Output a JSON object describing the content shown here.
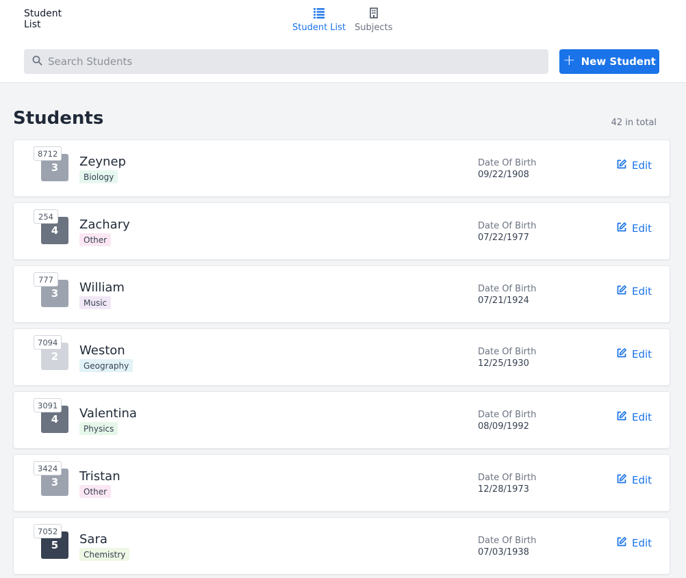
{
  "app": {
    "brand_line1": "Student",
    "brand_line2": "List"
  },
  "nav": [
    {
      "label": "Student List",
      "icon": "list-icon",
      "active": true
    },
    {
      "label": "Subjects",
      "icon": "building-icon",
      "active": false
    }
  ],
  "search": {
    "placeholder": "Search Students",
    "value": ""
  },
  "new_button": {
    "label": "New Student"
  },
  "page": {
    "title": "Students",
    "total": "42 in total"
  },
  "row_labels": {
    "dob": "Date Of Birth",
    "edit": "Edit"
  },
  "students": [
    {
      "id": "8712",
      "grade": "3",
      "grade_color": "#9ca3af",
      "name": "Zeynep",
      "subject": "Biology",
      "subject_color": "#e6f7ef",
      "dob": "09/22/1908"
    },
    {
      "id": "254",
      "grade": "4",
      "grade_color": "#6b7280",
      "name": "Zachary",
      "subject": "Other",
      "subject_color": "#fbe7f3",
      "dob": "07/22/1977"
    },
    {
      "id": "777",
      "grade": "3",
      "grade_color": "#9ca3af",
      "name": "William",
      "subject": "Music",
      "subject_color": "#f1e8f7",
      "dob": "07/21/1924"
    },
    {
      "id": "7094",
      "grade": "2",
      "grade_color": "#d1d5db",
      "name": "Weston",
      "subject": "Geography",
      "subject_color": "#e2f3f7",
      "dob": "12/25/1930"
    },
    {
      "id": "3091",
      "grade": "4",
      "grade_color": "#6b7280",
      "name": "Valentina",
      "subject": "Physics",
      "subject_color": "#e6f7e9",
      "dob": "08/09/1992"
    },
    {
      "id": "3424",
      "grade": "3",
      "grade_color": "#9ca3af",
      "name": "Tristan",
      "subject": "Other",
      "subject_color": "#fbe7f3",
      "dob": "12/28/1973"
    },
    {
      "id": "7052",
      "grade": "5",
      "grade_color": "#374151",
      "name": "Sara",
      "subject": "Chemistry",
      "subject_color": "#eef7e4",
      "dob": "07/03/1938"
    }
  ],
  "colors": {
    "accent": "#1a73e8",
    "background": "#f3f4f6"
  }
}
